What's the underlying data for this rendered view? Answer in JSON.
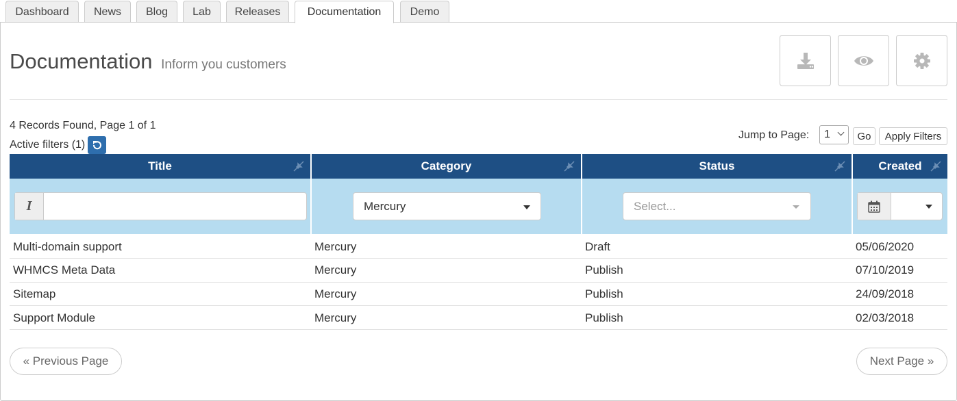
{
  "tabs": [
    {
      "label": "Dashboard"
    },
    {
      "label": "News"
    },
    {
      "label": "Blog"
    },
    {
      "label": "Lab"
    },
    {
      "label": "Releases"
    },
    {
      "label": "Documentation",
      "active": true
    },
    {
      "label": "Demo"
    }
  ],
  "header": {
    "title": "Documentation",
    "subtitle": "Inform you customers",
    "buttons": [
      "download-icon",
      "eye-icon",
      "gear-icon"
    ]
  },
  "info": {
    "records": "4 Records Found, Page 1 of 1",
    "active_filters": "Active filters (1)",
    "jump_label": "Jump to Page:",
    "jump_value": "1",
    "go_label": "Go",
    "apply_label": "Apply Filters"
  },
  "table": {
    "columns": [
      "Title",
      "Category",
      "Status",
      "Created"
    ],
    "filters": {
      "title_value": "",
      "category_value": "Mercury",
      "status_placeholder": "Select...",
      "created_value": ""
    },
    "rows": [
      {
        "title": "Multi-domain support",
        "category": "Mercury",
        "status": "Draft",
        "created": "05/06/2020"
      },
      {
        "title": "WHMCS Meta Data",
        "category": "Mercury",
        "status": "Publish",
        "created": "07/10/2019"
      },
      {
        "title": "Sitemap",
        "category": "Mercury",
        "status": "Publish",
        "created": "24/09/2018"
      },
      {
        "title": "Support Module",
        "category": "Mercury",
        "status": "Publish",
        "created": "02/03/2018"
      }
    ]
  },
  "pager": {
    "prev": "« Previous Page",
    "next": "Next Page »"
  },
  "colors": {
    "header_bg": "#1e4f84",
    "filter_bg": "#b6dcf0",
    "reset_btn": "#2e6ead"
  }
}
